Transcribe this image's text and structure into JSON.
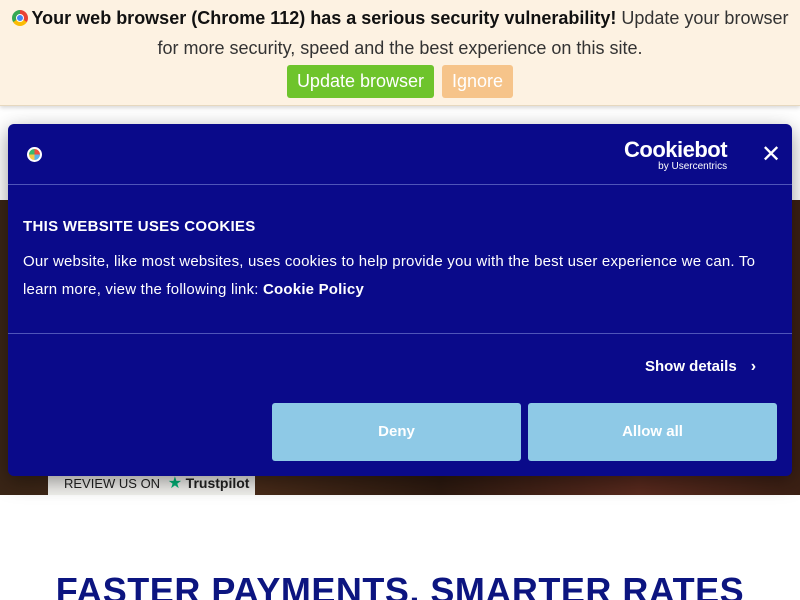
{
  "update_bar": {
    "warning_bold": "Your web browser (Chrome 112) has a serious security vulnerability!",
    "warning_rest_line1": " Update your browser",
    "warning_line2": "for more security, speed and the best experience on this site.",
    "update_button": "Update browser",
    "ignore_button": "Ignore"
  },
  "cookie_dialog": {
    "brand_name": "Cookiebot",
    "brand_sub": "by Usercentrics",
    "close_symbol": "✕",
    "title": "THIS WEBSITE USES COOKIES",
    "body_text": "Our website, like most websites, uses cookies to help provide you with the best user experience we can. To learn more, view the following link: ",
    "policy_link": "Cookie Policy",
    "show_details": "Show details",
    "deny_button": "Deny",
    "allow_all_button": "Allow all"
  },
  "trustpilot": {
    "review_text": "REVIEW US ON",
    "brand": "Trustpilot",
    "star_symbol": "★"
  },
  "headline": "FASTER PAYMENTS, SMARTER RATES",
  "colors": {
    "cookie_bg": "#0a0a8a",
    "cookie_button": "#8ec9e6",
    "update_button": "#6ec42c",
    "ignore_button": "#f6c48a",
    "update_bar_bg": "#fdf2e2",
    "headline": "#0c1580",
    "trustpilot_green": "#00b67a"
  }
}
